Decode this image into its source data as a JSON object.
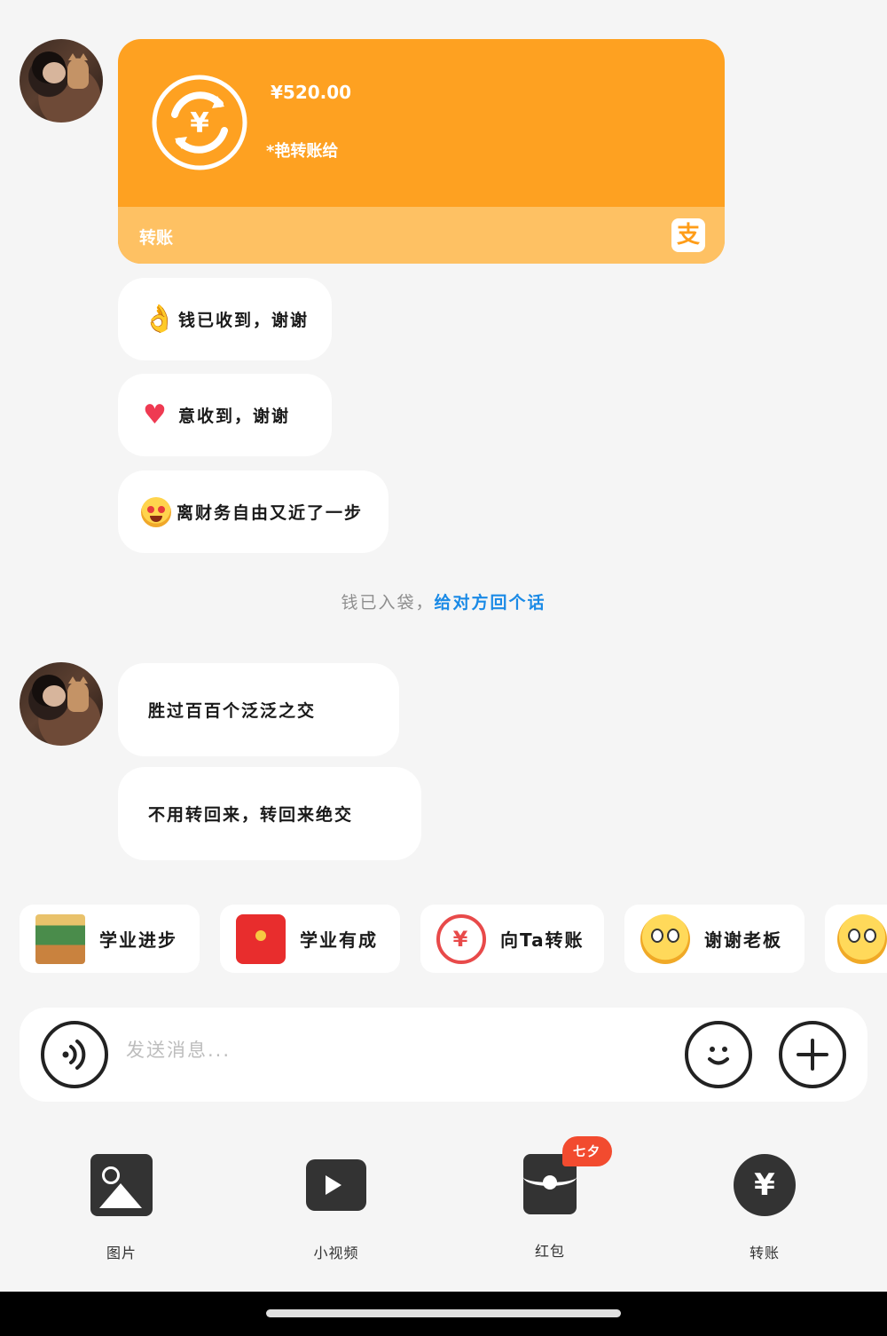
{
  "transfer_card": {
    "amount": "¥520.00",
    "note": "*艳转账给",
    "label": "转账"
  },
  "messages_1": [
    {
      "emoji": "ok-hand-icon",
      "text": "钱已收到，谢谢"
    },
    {
      "emoji": "heart-icon",
      "text": "意收到，谢谢"
    },
    {
      "emoji": "star-eyes-face-icon",
      "text": "离财务自由又近了一步"
    }
  ],
  "system_tip": {
    "text": "钱已入袋，",
    "link": "给对方回个话"
  },
  "messages_2": [
    {
      "text": "胜过百百个泛泛之交"
    },
    {
      "text": "不用转回来，转回来绝交"
    }
  ],
  "quick_replies": [
    {
      "icon": "chalkboard-sticker-icon",
      "label": "学业进步"
    },
    {
      "icon": "red-envelope-icon",
      "label": "学业有成"
    },
    {
      "icon": "transfer-icon",
      "label": "向Ta转账"
    },
    {
      "icon": "thank-boss-emoji-icon",
      "label": "谢谢老板"
    }
  ],
  "input_bar": {
    "placeholder": "发送消息..."
  },
  "tools": [
    {
      "icon": "photo-icon",
      "label": "图片"
    },
    {
      "icon": "video-icon",
      "label": "小视频"
    },
    {
      "icon": "red-packet-icon",
      "label": "红包",
      "badge": "七夕"
    },
    {
      "icon": "transfer-icon",
      "label": "转账"
    }
  ],
  "colors": {
    "background": "#f5f5f5",
    "transfer_orange": "#fea121",
    "transfer_light": "#fec163",
    "link_blue": "#1a8ae6",
    "badge_red": "#f24b2f"
  }
}
